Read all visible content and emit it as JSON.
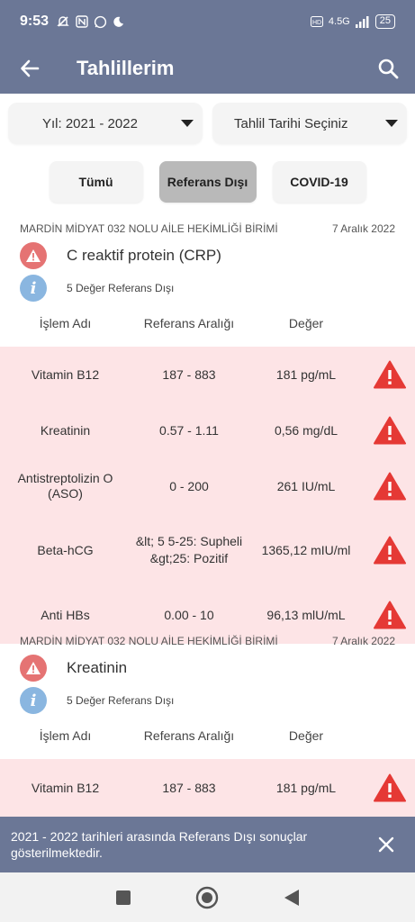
{
  "status": {
    "time": "9:53",
    "network": "4.5G",
    "battery": "25"
  },
  "app_bar": {
    "title": "Tahlillerim"
  },
  "filters": {
    "year": "Yıl: 2021 - 2022",
    "date": "Tahlil Tarihi Seçiniz"
  },
  "tabs": [
    {
      "label": "Tümü",
      "selected": false
    },
    {
      "label": "Referans Dışı",
      "selected": true
    },
    {
      "label": "COVID-19",
      "selected": false
    }
  ],
  "columns": {
    "name": "İşlem Adı",
    "range": "Referans Aralığı",
    "value": "Değer"
  },
  "sections": [
    {
      "facility": "MARDİN MİDYAT 032 NOLU AİLE HEKİMLİĞİ BİRİMİ",
      "date": "7 Aralık 2022",
      "title": "C reaktif protein (CRP)",
      "subtitle": "5 Değer Referans Dışı",
      "rows": [
        {
          "name": "Vitamin B12",
          "range": "187 - 883",
          "value": "181 pg/mL"
        },
        {
          "name": "Kreatinin",
          "range": "0.57 - 1.11",
          "value": "0,56 mg/dL"
        },
        {
          "name": "Antistreptolizin O (ASO)",
          "range": "0 - 200",
          "value": "261 IU/mL"
        },
        {
          "name": "Beta-hCG",
          "range": "&lt; 5 5-25: Supheli &gt;25: Pozitif",
          "value": "1365,12 mIU/ml"
        },
        {
          "name": "Anti HBs",
          "range": "0.00 - 10",
          "value": "96,13 mlU/mL"
        }
      ]
    },
    {
      "facility": "MARDİN MİDYAT 032 NOLU AİLE HEKİMLİĞİ BİRİMİ",
      "date": "7 Aralık 2022",
      "title": "Kreatinin",
      "subtitle": "5 Değer Referans Dışı",
      "rows": [
        {
          "name": "Vitamin B12",
          "range": "187 - 883",
          "value": "181 pg/mL"
        }
      ]
    }
  ],
  "snackbar": {
    "text": "2021 - 2022 tarihleri arasında Referans Dışı sonuçlar gösterilmektedir."
  },
  "colors": {
    "primary": "#6b7796",
    "warning": "#e53935",
    "row_bg": "#fde4e6",
    "info": "#8ab6e0"
  }
}
